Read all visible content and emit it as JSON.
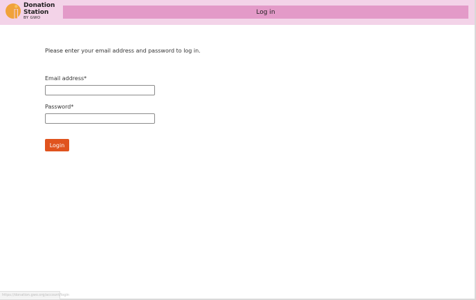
{
  "brand": {
    "line1": "Donation",
    "line2": "Station",
    "line3": "BY GWO",
    "logo_colors": {
      "mark_orange": "#f0a23a",
      "mark_dot": "#f7c25a"
    }
  },
  "header": {
    "title": "Log in",
    "background": "#f3d3e8",
    "title_bar_color": "#e39ac8"
  },
  "form": {
    "intro_text": "Please enter your email address and password to log in.",
    "email": {
      "label": "Email address*",
      "value": "",
      "placeholder": ""
    },
    "password": {
      "label": "Password*",
      "value": "",
      "placeholder": ""
    },
    "submit_label": "Login",
    "submit_color": "#e0531e"
  },
  "status_bar": {
    "url": "https://donation.gwo.org/account/login"
  }
}
